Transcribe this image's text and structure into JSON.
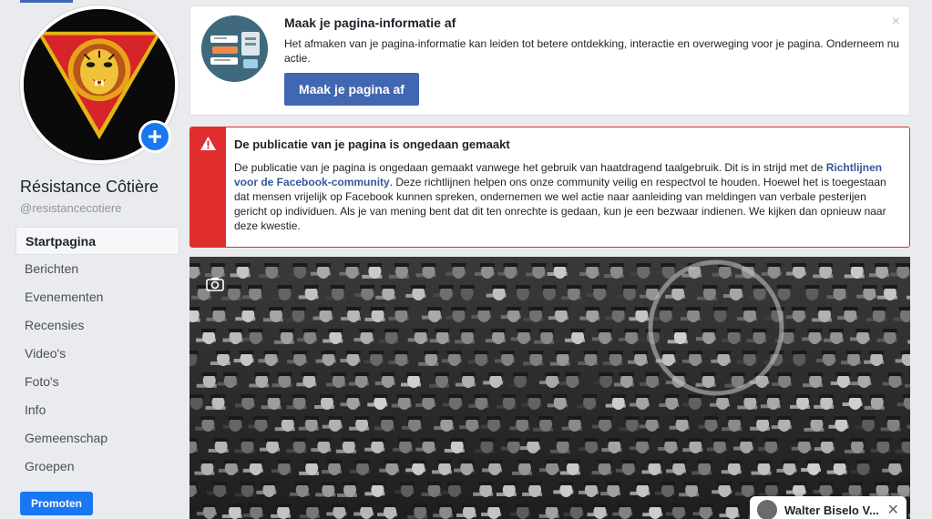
{
  "page": {
    "name": "Résistance Côtière",
    "handle": "@resistancecotiere"
  },
  "nav": {
    "items": [
      {
        "label": "Startpagina",
        "active": true
      },
      {
        "label": "Berichten"
      },
      {
        "label": "Evenementen"
      },
      {
        "label": "Recensies"
      },
      {
        "label": "Video's"
      },
      {
        "label": "Foto's"
      },
      {
        "label": "Info"
      },
      {
        "label": "Gemeenschap"
      },
      {
        "label": "Groepen"
      }
    ],
    "promote_label": "Promoten"
  },
  "info_card": {
    "title": "Maak je pagina-informatie af",
    "description": "Het afmaken van je pagina-informatie kan leiden tot betere ontdekking, interactie en overweging voor je pagina. Onderneem nu actie.",
    "button_label": "Maak je pagina af",
    "close_symbol": "×"
  },
  "warning_card": {
    "title": "De publicatie van je pagina is ongedaan gemaakt",
    "body_before_link": "De publicatie van je pagina is ongedaan gemaakt vanwege het gebruik van haatdragend taalgebruik. Dit is in strijd met de ",
    "link_text": "Richtlijnen voor de Facebook-community",
    "body_after_link": ". Deze richtlijnen helpen ons onze community veilig en respectvol te houden. Hoewel het is toegestaan dat mensen vrijelijk op Facebook kunnen spreken, ondernemen we wel actie naar aanleiding van meldingen van verbale pesterijen gericht op individuen. Als je van mening bent dat dit ten onrechte is gedaan, kun je een bezwaar indienen. We kijken dan opnieuw naar deze kwestie."
  },
  "chat": {
    "name": "Walter Biselo V...",
    "close_symbol": "✕"
  },
  "colors": {
    "fb_blue": "#4267b2",
    "promote_blue": "#1877f2",
    "warning_red": "#e02d2d",
    "link": "#365899"
  },
  "icons": [
    "plus-icon",
    "camera-icon",
    "warning-triangle-icon",
    "close-icon"
  ]
}
